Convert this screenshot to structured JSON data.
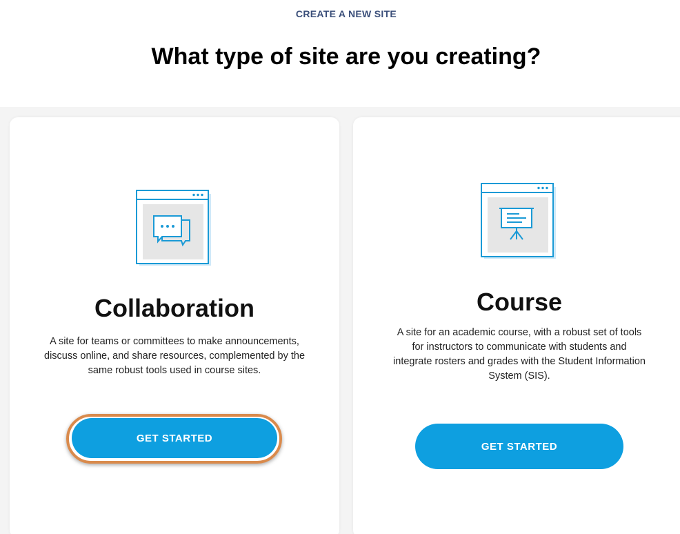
{
  "header": {
    "eyebrow": "CREATE A NEW SITE",
    "title": "What type of site are you creating?"
  },
  "cards": [
    {
      "title": "Collaboration",
      "description": "A site for teams or committees to make announcements, discuss online, and share resources, complemented by the same robust tools used in course sites.",
      "button_label": "GET STARTED",
      "icon": "chat-bubbles-window-icon",
      "highlighted": true
    },
    {
      "title": "Course",
      "description": "A site for an academic course, with a robust set of tools for instructors to communicate with students and integrate rosters and grades with the Student Information System (SIS).",
      "button_label": "GET STARTED",
      "icon": "presentation-board-window-icon",
      "highlighted": false
    }
  ],
  "colors": {
    "accent": "#0e9fe0",
    "eyebrow": "#3b4f7a",
    "highlight_ring": "#d98a4c",
    "icon_stroke": "#1a9ad6"
  }
}
